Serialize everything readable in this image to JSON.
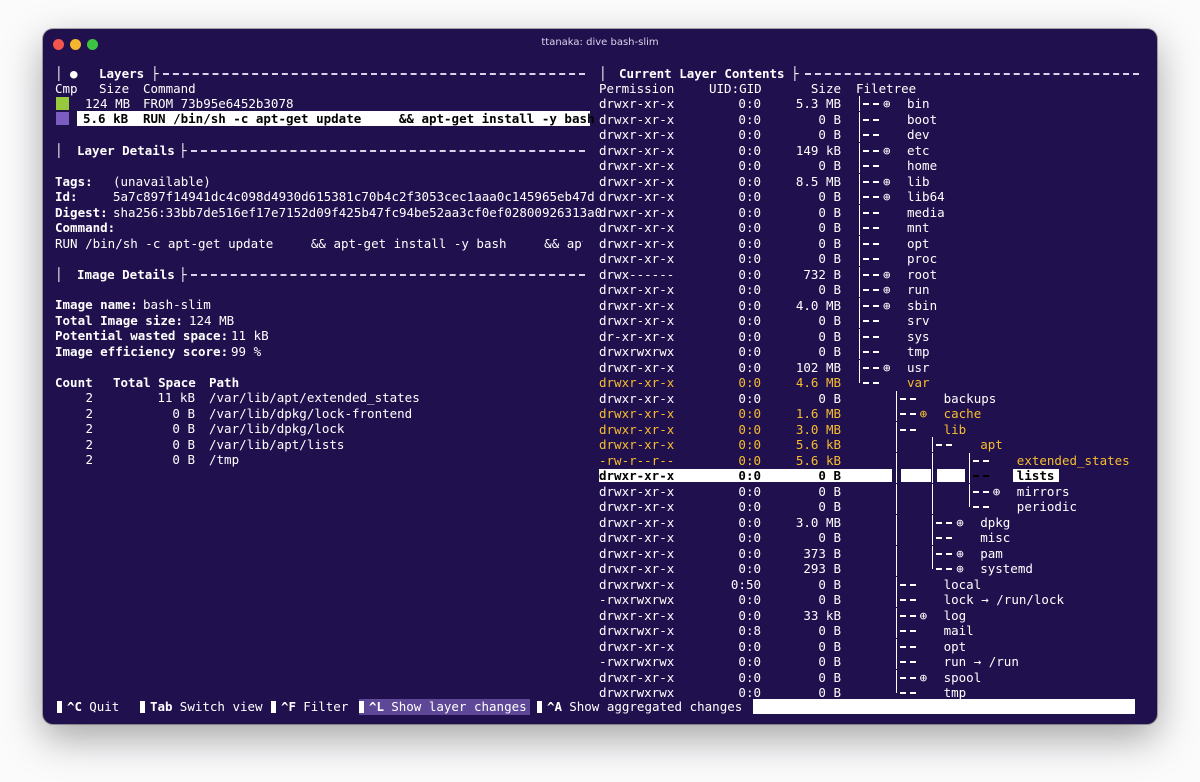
{
  "window": {
    "title": "ttanaka: dive bash-slim"
  },
  "layers": {
    "title": "Layers",
    "headers": {
      "cmp": "Cmp",
      "size": "Size",
      "command": "Command"
    },
    "rows": [
      {
        "size": "124 MB",
        "command": "FROM 73b95e6452b3078",
        "swatch": "#97c93d"
      },
      {
        "size": "5.6 kB",
        "command": "RUN /bin/sh -c apt-get update     && apt-get install -y bash",
        "swatch": "#7b5cc0"
      }
    ]
  },
  "layer_details": {
    "title": "Layer Details",
    "tags_label": "Tags:",
    "tags_value": "(unavailable)",
    "id_label": "Id:",
    "id_value": "5a7c897f14941dc4c098d4930d615381c70b4c2f3053cec1aaa0c145965eb47d",
    "digest_label": "Digest:",
    "digest_value": "sha256:33bb7de516ef17e7152d09f425b47fc94be52aa3cf0ef02800926313a0",
    "command_label": "Command:",
    "command_value": "RUN /bin/sh -c apt-get update     && apt-get install -y bash     && apt-g"
  },
  "image_details": {
    "title": "Image Details",
    "name_label": "Image name:",
    "name_value": "bash-slim",
    "size_label": "Total Image size:",
    "size_value": "124 MB",
    "wasted_label": "Potential wasted space:",
    "wasted_value": "11 kB",
    "eff_label": "Image efficiency score:",
    "eff_value": "99 %",
    "table_headers": {
      "count": "Count",
      "total": "Total Space",
      "path": "Path"
    },
    "rows": [
      {
        "count": "2",
        "total": "11 kB",
        "path": "/var/lib/apt/extended_states"
      },
      {
        "count": "2",
        "total": "0 B",
        "path": "/var/lib/dpkg/lock-frontend"
      },
      {
        "count": "2",
        "total": "0 B",
        "path": "/var/lib/dpkg/lock"
      },
      {
        "count": "2",
        "total": "0 B",
        "path": "/var/lib/apt/lists"
      },
      {
        "count": "2",
        "total": "0 B",
        "path": "/tmp"
      }
    ]
  },
  "contents": {
    "title": "Current Layer Contents",
    "headers": {
      "perm": "Permission",
      "uid": "UID:GID",
      "size": "Size",
      "tree": "Filetree"
    },
    "rows": [
      {
        "perm": "drwxr-xr-x",
        "uid": "0:0",
        "size": "5.3 MB",
        "name": "bin",
        "icon": "⊕"
      },
      {
        "perm": "drwxr-xr-x",
        "uid": "0:0",
        "size": "0 B",
        "name": "boot",
        "icon": ""
      },
      {
        "perm": "drwxr-xr-x",
        "uid": "0:0",
        "size": "0 B",
        "name": "dev",
        "icon": ""
      },
      {
        "perm": "drwxr-xr-x",
        "uid": "0:0",
        "size": "149 kB",
        "name": "etc",
        "icon": "⊕"
      },
      {
        "perm": "drwxr-xr-x",
        "uid": "0:0",
        "size": "0 B",
        "name": "home",
        "icon": ""
      },
      {
        "perm": "drwxr-xr-x",
        "uid": "0:0",
        "size": "8.5 MB",
        "name": "lib",
        "icon": "⊕"
      },
      {
        "perm": "drwxr-xr-x",
        "uid": "0:0",
        "size": "0 B",
        "name": "lib64",
        "icon": "⊕"
      },
      {
        "perm": "drwxr-xr-x",
        "uid": "0:0",
        "size": "0 B",
        "name": "media",
        "icon": ""
      },
      {
        "perm": "drwxr-xr-x",
        "uid": "0:0",
        "size": "0 B",
        "name": "mnt",
        "icon": ""
      },
      {
        "perm": "drwxr-xr-x",
        "uid": "0:0",
        "size": "0 B",
        "name": "opt",
        "icon": ""
      },
      {
        "perm": "drwxr-xr-x",
        "uid": "0:0",
        "size": "0 B",
        "name": "proc",
        "icon": ""
      },
      {
        "perm": "drwx------",
        "uid": "0:0",
        "size": "732 B",
        "name": "root",
        "icon": "⊕"
      },
      {
        "perm": "drwxr-xr-x",
        "uid": "0:0",
        "size": "0 B",
        "name": "run",
        "icon": "⊕"
      },
      {
        "perm": "drwxr-xr-x",
        "uid": "0:0",
        "size": "4.0 MB",
        "name": "sbin",
        "icon": "⊕"
      },
      {
        "perm": "drwxr-xr-x",
        "uid": "0:0",
        "size": "0 B",
        "name": "srv",
        "icon": ""
      },
      {
        "perm": "dr-xr-xr-x",
        "uid": "0:0",
        "size": "0 B",
        "name": "sys",
        "icon": ""
      },
      {
        "perm": "drwxrwxrwx",
        "uid": "0:0",
        "size": "0 B",
        "name": "tmp",
        "icon": ""
      },
      {
        "perm": "drwxr-xr-x",
        "uid": "0:0",
        "size": "102 MB",
        "name": "usr",
        "icon": "⊕"
      },
      {
        "perm": "drwxr-xr-x",
        "uid": "0:0",
        "size": "4.6 MB",
        "name": "var",
        "icon": ""
      },
      {
        "perm": "drwxr-xr-x",
        "uid": "0:0",
        "size": "0 B",
        "name": "backups",
        "icon": ""
      },
      {
        "perm": "drwxr-xr-x",
        "uid": "0:0",
        "size": "1.6 MB",
        "name": "cache",
        "icon": "⊕"
      },
      {
        "perm": "drwxr-xr-x",
        "uid": "0:0",
        "size": "3.0 MB",
        "name": "lib",
        "icon": ""
      },
      {
        "perm": "drwxr-xr-x",
        "uid": "0:0",
        "size": "5.6 kB",
        "name": "apt",
        "icon": ""
      },
      {
        "perm": "-rw-r--r--",
        "uid": "0:0",
        "size": "5.6 kB",
        "name": "extended_states",
        "icon": ""
      },
      {
        "perm": "drwxr-xr-x",
        "uid": "0:0",
        "size": "0 B",
        "name": "lists",
        "icon": ""
      },
      {
        "perm": "drwxr-xr-x",
        "uid": "0:0",
        "size": "0 B",
        "name": "mirrors",
        "icon": "⊕"
      },
      {
        "perm": "drwxr-xr-x",
        "uid": "0:0",
        "size": "0 B",
        "name": "periodic",
        "icon": ""
      },
      {
        "perm": "drwxr-xr-x",
        "uid": "0:0",
        "size": "3.0 MB",
        "name": "dpkg",
        "icon": "⊕"
      },
      {
        "perm": "drwxr-xr-x",
        "uid": "0:0",
        "size": "0 B",
        "name": "misc",
        "icon": ""
      },
      {
        "perm": "drwxr-xr-x",
        "uid": "0:0",
        "size": "373 B",
        "name": "pam",
        "icon": "⊕"
      },
      {
        "perm": "drwxr-xr-x",
        "uid": "0:0",
        "size": "293 B",
        "name": "systemd",
        "icon": "⊕"
      },
      {
        "perm": "drwxrwxr-x",
        "uid": "0:50",
        "size": "0 B",
        "name": "local",
        "icon": ""
      },
      {
        "perm": "-rwxrwxrwx",
        "uid": "0:0",
        "size": "0 B",
        "name": "lock → /run/lock",
        "icon": ""
      },
      {
        "perm": "drwxr-xr-x",
        "uid": "0:0",
        "size": "33 kB",
        "name": "log",
        "icon": "⊕"
      },
      {
        "perm": "drwxrwxr-x",
        "uid": "0:8",
        "size": "0 B",
        "name": "mail",
        "icon": ""
      },
      {
        "perm": "drwxr-xr-x",
        "uid": "0:0",
        "size": "0 B",
        "name": "opt",
        "icon": ""
      },
      {
        "perm": "-rwxrwxrwx",
        "uid": "0:0",
        "size": "0 B",
        "name": "run → /run",
        "icon": ""
      },
      {
        "perm": "drwxr-xr-x",
        "uid": "0:0",
        "size": "0 B",
        "name": "spool",
        "icon": "⊕"
      },
      {
        "perm": "drwxrwxrwx",
        "uid": "0:0",
        "size": "0 B",
        "name": "tmp",
        "icon": ""
      }
    ]
  },
  "footer": {
    "items": [
      {
        "key": "^C",
        "label": "Quit"
      },
      {
        "key": "Tab",
        "label": "Switch view"
      },
      {
        "key": "^F",
        "label": "Filter"
      },
      {
        "key": "^L",
        "label": "Show layer changes"
      },
      {
        "key": "^A",
        "label": "Show aggregated changes"
      }
    ]
  },
  "colors": {
    "background": "#21104e",
    "highlight": "#f5bd30",
    "active_footer": "#5d4796",
    "layer1": "#97c93d",
    "layer2": "#7b5cc0"
  }
}
